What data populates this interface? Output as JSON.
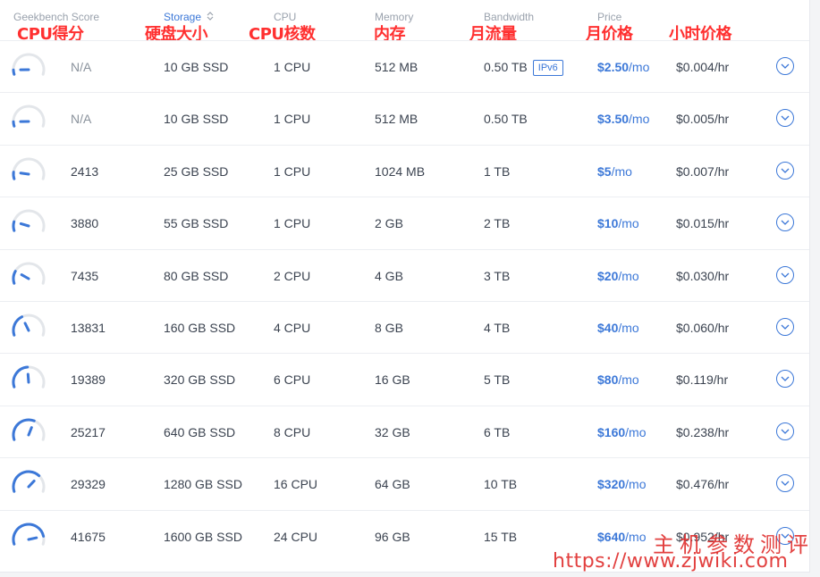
{
  "columns": {
    "geekbench": "Geekbench Score",
    "storage": "Storage",
    "cpu": "CPU",
    "memory": "Memory",
    "bandwidth": "Bandwidth",
    "price": "Price"
  },
  "annotations": {
    "cpu_score": "CPU得分",
    "disk_size": "硬盘大小",
    "cpu_cores": "CPU核数",
    "memory": "内存",
    "monthly_traffic": "月流量",
    "monthly_price": "月价格",
    "hourly_price": "小时价格"
  },
  "colors": {
    "accent": "#3c78d8",
    "annotation": "#ff3030",
    "watermark": "#e0302f"
  },
  "rows": [
    {
      "gauge_level": 0.08,
      "score": "N/A",
      "storage": "10 GB SSD",
      "cpu": "1 CPU",
      "memory": "512 MB",
      "bandwidth": "0.50 TB",
      "badge": "IPv6",
      "price": "$2.50",
      "price_unit": "/mo",
      "hourly": "$0.004/hr"
    },
    {
      "gauge_level": 0.08,
      "score": "N/A",
      "storage": "10 GB SSD",
      "cpu": "1 CPU",
      "memory": "512 MB",
      "bandwidth": "0.50 TB",
      "badge": "",
      "price": "$3.50",
      "price_unit": "/mo",
      "hourly": "$0.005/hr"
    },
    {
      "gauge_level": 0.12,
      "score": "2413",
      "storage": "25 GB SSD",
      "cpu": "1 CPU",
      "memory": "1024 MB",
      "bandwidth": "1 TB",
      "badge": "",
      "price": "$5",
      "price_unit": "/mo",
      "hourly": "$0.007/hr"
    },
    {
      "gauge_level": 0.16,
      "score": "3880",
      "storage": "55 GB SSD",
      "cpu": "1 CPU",
      "memory": "2 GB",
      "bandwidth": "2 TB",
      "badge": "",
      "price": "$10",
      "price_unit": "/mo",
      "hourly": "$0.015/hr"
    },
    {
      "gauge_level": 0.22,
      "score": "7435",
      "storage": "80 GB SSD",
      "cpu": "2 CPU",
      "memory": "4 GB",
      "bandwidth": "3 TB",
      "badge": "",
      "price": "$20",
      "price_unit": "/mo",
      "hourly": "$0.030/hr"
    },
    {
      "gauge_level": 0.38,
      "score": "13831",
      "storage": "160 GB SSD",
      "cpu": "4 CPU",
      "memory": "8 GB",
      "bandwidth": "4 TB",
      "badge": "",
      "price": "$40",
      "price_unit": "/mo",
      "hourly": "$0.060/hr"
    },
    {
      "gauge_level": 0.48,
      "score": "19389",
      "storage": "320 GB SSD",
      "cpu": "6 CPU",
      "memory": "16 GB",
      "bandwidth": "5 TB",
      "badge": "",
      "price": "$80",
      "price_unit": "/mo",
      "hourly": "$0.119/hr"
    },
    {
      "gauge_level": 0.6,
      "score": "25217",
      "storage": "640 GB SSD",
      "cpu": "8 CPU",
      "memory": "32 GB",
      "bandwidth": "6 TB",
      "badge": "",
      "price": "$160",
      "price_unit": "/mo",
      "hourly": "$0.238/hr"
    },
    {
      "gauge_level": 0.7,
      "score": "29329",
      "storage": "1280 GB SSD",
      "cpu": "16 CPU",
      "memory": "64 GB",
      "bandwidth": "10 TB",
      "badge": "",
      "price": "$320",
      "price_unit": "/mo",
      "hourly": "$0.476/hr"
    },
    {
      "gauge_level": 0.86,
      "score": "41675",
      "storage": "1600 GB SSD",
      "cpu": "24 CPU",
      "memory": "96 GB",
      "bandwidth": "15 TB",
      "badge": "",
      "price": "$640",
      "price_unit": "/mo",
      "hourly": "$0.952/hr"
    }
  ],
  "watermark": {
    "title": "主机参数测评",
    "url": "https://www.zjwiki.com"
  }
}
